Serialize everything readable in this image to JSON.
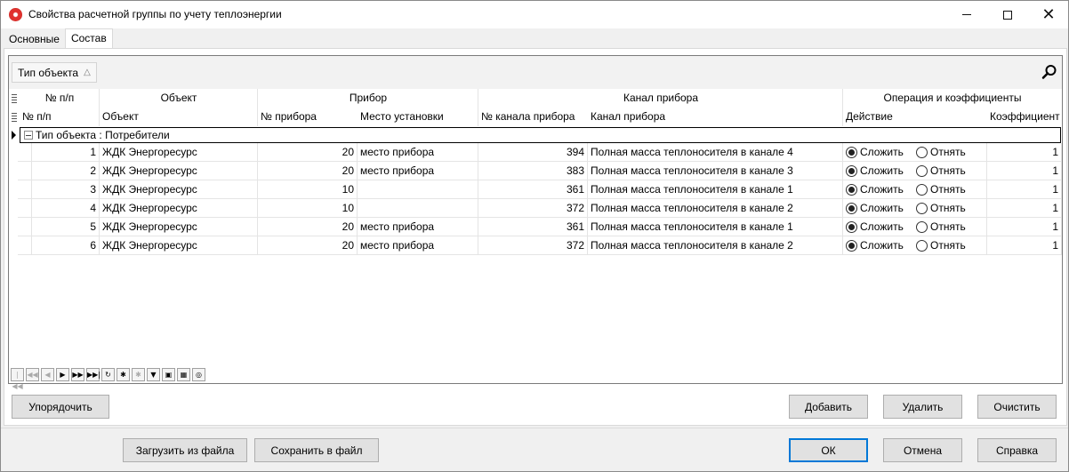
{
  "window": {
    "title": "Свойства расчетной группы по учету теплоэнергии"
  },
  "tabs": [
    {
      "label": "Основные",
      "active": false
    },
    {
      "label": "Состав",
      "active": true
    }
  ],
  "group_panel": {
    "chip_label": "Тип объекта"
  },
  "header": {
    "bands": {
      "num": "№ п/п",
      "object": "Объект",
      "device": "Прибор",
      "channel": "Канал прибора",
      "operation": "Операция и коэффициенты"
    },
    "columns": {
      "num": "№ п/п",
      "object": "Объект",
      "device_no": "№ прибора",
      "location": "Место установки",
      "channel_no": "№ канала прибора",
      "channel": "Канал прибора",
      "action": "Действие",
      "coef": "Коэффициент"
    }
  },
  "group_row": {
    "label": "Тип объекта : Потребители"
  },
  "radio_labels": {
    "add": "Сложить",
    "subtract": "Отнять"
  },
  "rows": [
    {
      "num": "1",
      "object": "ЖДК Энергоресурс",
      "device_no": "20",
      "location": "место прибора",
      "channel_no": "394",
      "channel": "Полная масса теплоносителя в канале 4",
      "action": "add",
      "coef": "1"
    },
    {
      "num": "2",
      "object": "ЖДК Энергоресурс",
      "device_no": "20",
      "location": "место прибора",
      "channel_no": "383",
      "channel": "Полная масса теплоносителя в канале 3",
      "action": "add",
      "coef": "1"
    },
    {
      "num": "3",
      "object": "ЖДК Энергоресурс",
      "device_no": "10",
      "location": "",
      "channel_no": "361",
      "channel": "Полная масса теплоносителя в канале 1",
      "action": "add",
      "coef": "1"
    },
    {
      "num": "4",
      "object": "ЖДК Энергоресурс",
      "device_no": "10",
      "location": "",
      "channel_no": "372",
      "channel": "Полная масса теплоносителя в канале 2",
      "action": "add",
      "coef": "1"
    },
    {
      "num": "5",
      "object": "ЖДК Энергоресурс",
      "device_no": "20",
      "location": "место прибора",
      "channel_no": "361",
      "channel": "Полная масса теплоносителя в канале 1",
      "action": "add",
      "coef": "1"
    },
    {
      "num": "6",
      "object": "ЖДК Энергоресурс",
      "device_no": "20",
      "location": "место прибора",
      "channel_no": "372",
      "channel": "Полная масса теплоносителя в канале 2",
      "action": "add",
      "coef": "1"
    }
  ],
  "navigator": {
    "buttons": [
      {
        "icon": "first-page-icon",
        "glyph": "|◀◀",
        "enabled": false
      },
      {
        "icon": "prev-page-icon",
        "glyph": "◀◀",
        "enabled": false
      },
      {
        "icon": "prev-record-icon",
        "glyph": "◀",
        "enabled": false
      },
      {
        "icon": "next-record-icon",
        "glyph": "▶",
        "enabled": true
      },
      {
        "icon": "next-page-icon",
        "glyph": "▶▶",
        "enabled": true
      },
      {
        "icon": "last-page-icon",
        "glyph": "▶▶|",
        "enabled": true
      },
      {
        "icon": "refresh-icon",
        "glyph": "↻",
        "enabled": true
      },
      {
        "icon": "insert-icon",
        "glyph": "✱",
        "enabled": true
      },
      {
        "icon": "delete-icon",
        "glyph": "✱",
        "enabled": false
      },
      {
        "icon": "filter-icon",
        "glyph": "▼",
        "enabled": true
      },
      {
        "icon": "export-icon",
        "glyph": "▣",
        "enabled": true
      },
      {
        "icon": "grid-settings-icon",
        "glyph": "▦",
        "enabled": true
      },
      {
        "icon": "find-icon",
        "glyph": "◎",
        "enabled": true
      }
    ]
  },
  "buttons": {
    "sort": "Упорядочить",
    "add": "Добавить",
    "delete": "Удалить",
    "clear": "Очистить",
    "load": "Загрузить из файла",
    "save": "Сохранить в файл",
    "ok": "ОК",
    "cancel": "Отмена",
    "help": "Справка"
  },
  "colors": {
    "default_button_border": "#0078d7",
    "app_icon": "#e0322e"
  }
}
